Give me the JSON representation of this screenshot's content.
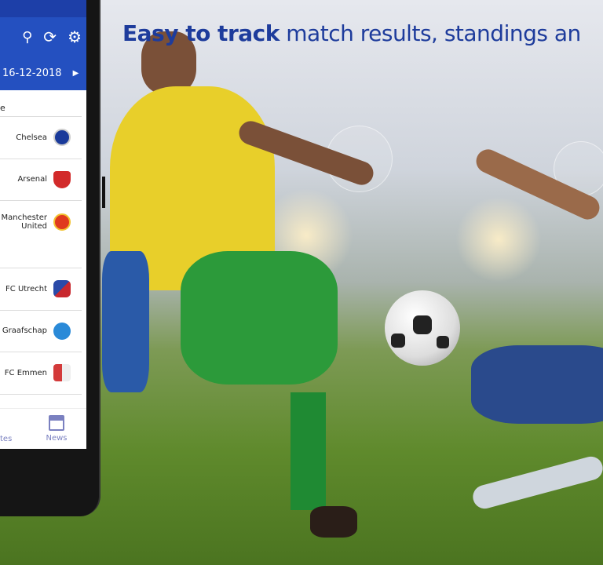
{
  "headline": {
    "bold": "Easy to track",
    "rest": " match results, standings an"
  },
  "app": {
    "toolbar_icons": [
      "search-icon",
      "refresh-icon",
      "gear-icon"
    ],
    "date": "16-12-2018",
    "list_header": "e",
    "teams": [
      {
        "name": "Chelsea",
        "color": "#1a3a9a"
      },
      {
        "name": "Arsenal",
        "color": "#d22a2a"
      },
      {
        "name": "Manchester United",
        "color": "#e03a1e"
      },
      {
        "name": ""
      },
      {
        "name": "FC Utrecht",
        "color": "#c8282e"
      },
      {
        "name": "Graafschap",
        "color": "#2a8ad8"
      },
      {
        "name": "FC Emmen",
        "color": "#d33a3a"
      }
    ],
    "nav": {
      "partial": "tes",
      "news": "News"
    }
  },
  "colors": {
    "brand": "#2450c0",
    "headline": "#1e3c9c"
  }
}
